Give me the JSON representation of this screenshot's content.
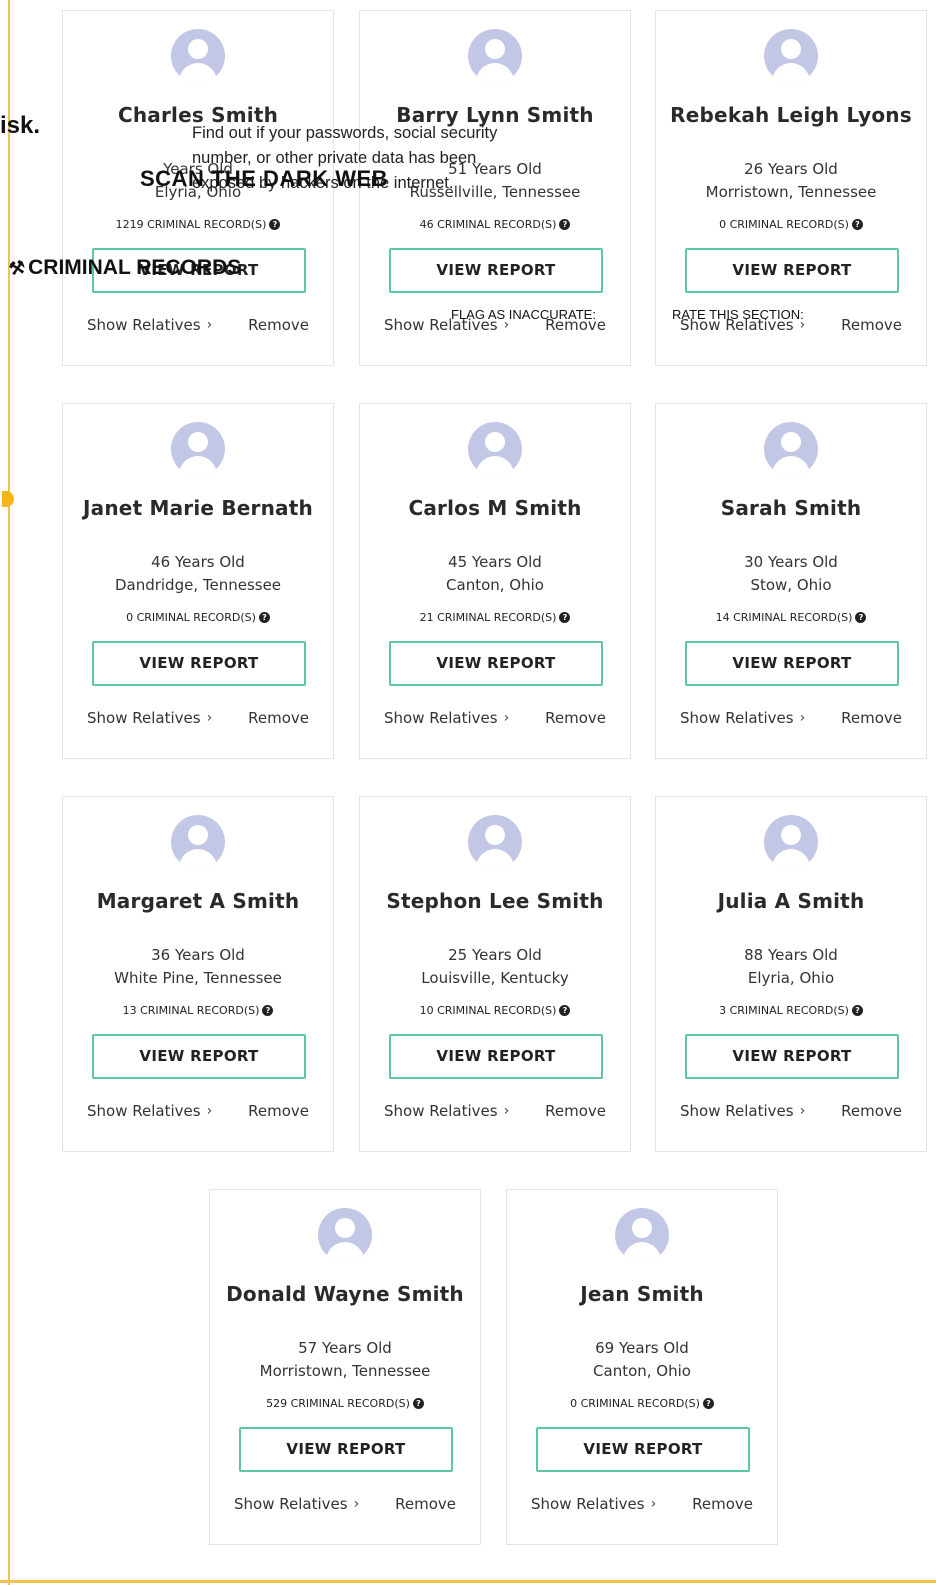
{
  "overlay": {
    "risk_text": "isk.",
    "dark_web_desc": "Find out if your passwords, social security number, or other private data has been exposed by hackers on the internet.",
    "scan_label": "SCAN THE DARK WEB",
    "criminal_records_label": "CRIMINAL RECORDS",
    "flag_label": "FLAG AS INACCURATE:",
    "rate_label": "RATE THIS SECTION:"
  },
  "colors": {
    "accent_border": "#5cc7a4",
    "avatar": "#c3c7e6",
    "frame": "#f2c14e"
  },
  "people": [
    {
      "name": "Charles Smith",
      "age": "Years Old",
      "location": "Elyria, Ohio",
      "records": "1219 CRIMINAL RECORD(S)",
      "button": "VIEW REPORT",
      "relatives": "Show Relatives",
      "remove": "Remove"
    },
    {
      "name": "Barry Lynn Smith",
      "age": "51 Years Old",
      "location": "Russellville, Tennessee",
      "records": "46 CRIMINAL RECORD(S)",
      "button": "VIEW REPORT",
      "relatives": "Show Relatives",
      "remove": "Remove"
    },
    {
      "name": "Rebekah Leigh Lyons",
      "age": "26 Years Old",
      "location": "Morristown, Tennessee",
      "records": "0 CRIMINAL RECORD(S)",
      "button": "VIEW REPORT",
      "relatives": "Show Relatives",
      "remove": "Remove"
    },
    {
      "name": "Janet Marie Bernath",
      "age": "46 Years Old",
      "location": "Dandridge, Tennessee",
      "records": "0 CRIMINAL RECORD(S)",
      "button": "VIEW REPORT",
      "relatives": "Show Relatives",
      "remove": "Remove"
    },
    {
      "name": "Carlos M Smith",
      "age": "45 Years Old",
      "location": "Canton, Ohio",
      "records": "21 CRIMINAL RECORD(S)",
      "button": "VIEW REPORT",
      "relatives": "Show Relatives",
      "remove": "Remove"
    },
    {
      "name": "Sarah Smith",
      "age": "30 Years Old",
      "location": "Stow, Ohio",
      "records": "14 CRIMINAL RECORD(S)",
      "button": "VIEW REPORT",
      "relatives": "Show Relatives",
      "remove": "Remove"
    },
    {
      "name": "Margaret A Smith",
      "age": "36 Years Old",
      "location": "White Pine, Tennessee",
      "records": "13 CRIMINAL RECORD(S)",
      "button": "VIEW REPORT",
      "relatives": "Show Relatives",
      "remove": "Remove"
    },
    {
      "name": "Stephon Lee Smith",
      "age": "25 Years Old",
      "location": "Louisville, Kentucky",
      "records": "10 CRIMINAL RECORD(S)",
      "button": "VIEW REPORT",
      "relatives": "Show Relatives",
      "remove": "Remove"
    },
    {
      "name": "Julia A Smith",
      "age": "88 Years Old",
      "location": "Elyria, Ohio",
      "records": "3 CRIMINAL RECORD(S)",
      "button": "VIEW REPORT",
      "relatives": "Show Relatives",
      "remove": "Remove"
    },
    {
      "name": "Donald Wayne Smith",
      "age": "57 Years Old",
      "location": "Morristown, Tennessee",
      "records": "529 CRIMINAL RECORD(S)",
      "button": "VIEW REPORT",
      "relatives": "Show Relatives",
      "remove": "Remove"
    },
    {
      "name": "Jean Smith",
      "age": "69 Years Old",
      "location": "Canton, Ohio",
      "records": "0 CRIMINAL RECORD(S)",
      "button": "VIEW REPORT",
      "relatives": "Show Relatives",
      "remove": "Remove"
    }
  ]
}
